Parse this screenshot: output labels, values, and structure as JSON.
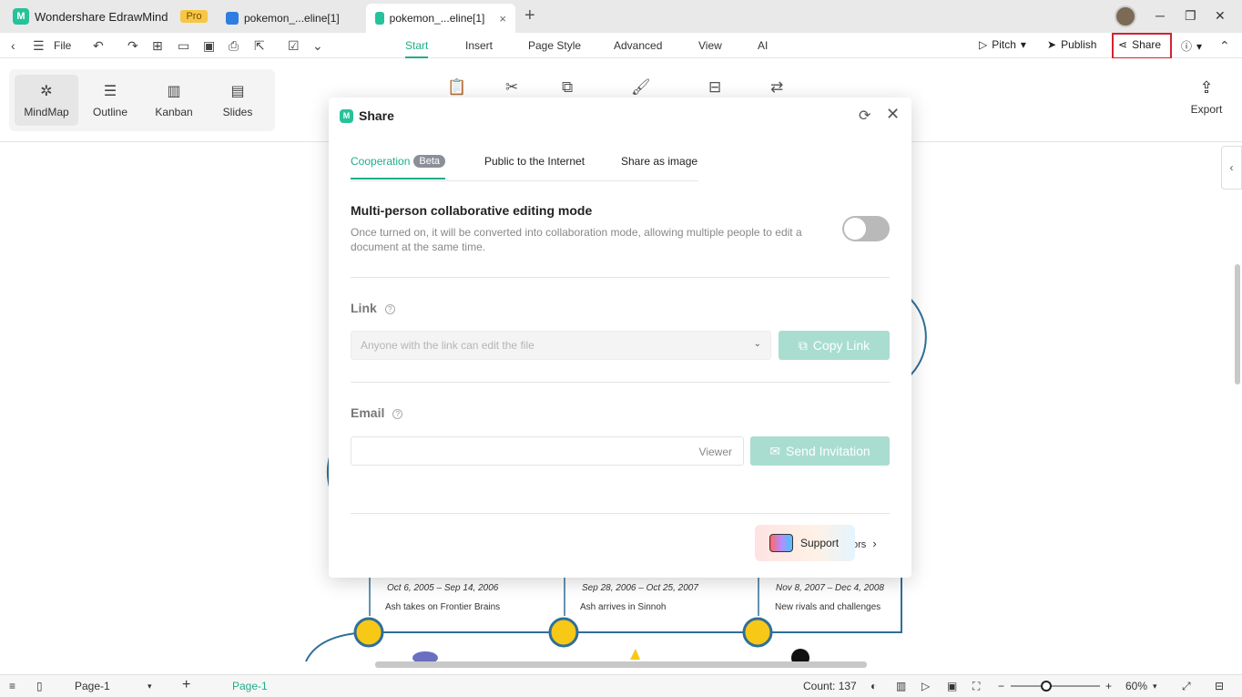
{
  "titlebar": {
    "app_name": "Wondershare EdrawMind",
    "badge": "Pro",
    "tabs": [
      {
        "label": "pokemon_...eline[1]"
      },
      {
        "label": "pokemon_...eline[1]"
      }
    ],
    "close_tab": "×",
    "new_tab": "+",
    "win_minimize": "─",
    "win_restore": "❐",
    "win_close": "✕"
  },
  "menubar": {
    "file": "File",
    "tabs": [
      "Start",
      "Insert",
      "Page Style",
      "Advanced",
      "View",
      "AI"
    ],
    "pitch": "Pitch",
    "publish": "Publish",
    "share": "Share"
  },
  "toolbar": {
    "views": [
      "MindMap",
      "Outline",
      "Kanban",
      "Slides"
    ],
    "export": "Export"
  },
  "canvas": {
    "nodes": [
      {
        "date": "Oct 6, 2005 – Sep 14, 2006",
        "text": "Ash takes on Frontier Brains"
      },
      {
        "date": "Sep 28, 2006 – Oct 25, 2007",
        "text": "Ash arrives in Sinnoh"
      },
      {
        "date": "Nov 8, 2007 – Dec 4, 2008",
        "text": "New rivals and challenges"
      }
    ]
  },
  "modal": {
    "title": "Share",
    "tabs": {
      "cooperation": "Cooperation",
      "beta": "Beta",
      "public": "Public to the Internet",
      "image": "Share as image"
    },
    "collab": {
      "title": "Multi-person collaborative editing mode",
      "desc": "Once turned on, it will be converted into collaboration mode, allowing multiple people to edit a document at the same time.",
      "enabled": false
    },
    "link": {
      "title": "Link",
      "select_value": "Anyone with the link can edit the file",
      "copy_button": "Copy Link"
    },
    "email": {
      "title": "Email",
      "placeholder": "",
      "role": "Viewer",
      "send_button": "Send Invitation"
    },
    "footer": {
      "support": "Support",
      "more_fragment": "ors"
    }
  },
  "statusbar": {
    "page_select": "Page-1",
    "page_tab": "Page-1",
    "count": "Count: 137",
    "zoom": "60%",
    "zoom_level": 0.4
  },
  "colors": {
    "accent": "#1fae89",
    "node_yellow": "#f8c817",
    "line_blue": "#2f6f99",
    "highlight_red": "#d3232f"
  }
}
